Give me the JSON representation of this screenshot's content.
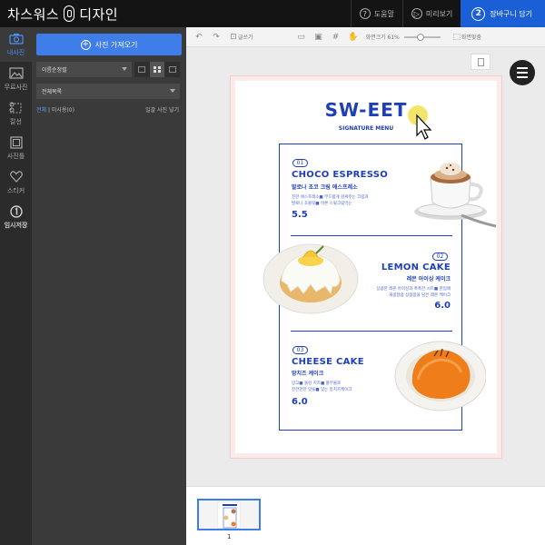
{
  "app": {
    "brand_left": "차스워스",
    "brand_right": "디자인"
  },
  "header": {
    "help": "도움말",
    "preview": "미리보기",
    "cart_step": "2",
    "cart": "장바구니 담기",
    "help_icon": "?",
    "preview_icon": "▷"
  },
  "rail": [
    {
      "label": "내사진",
      "icon": "camera-icon",
      "active": true
    },
    {
      "label": "무료사진",
      "icon": "landscape-icon",
      "active": false
    },
    {
      "label": "칼선",
      "icon": "scissors-icon",
      "active": false
    },
    {
      "label": "사진틀",
      "icon": "frame-icon",
      "active": false
    },
    {
      "label": "스티커",
      "icon": "heart-icon",
      "active": false
    },
    {
      "label": "임시저장",
      "icon": "save-one-icon",
      "active": false
    }
  ],
  "panel": {
    "import_button": "사진 가져오기",
    "sort_select": "이름순정렬",
    "folder_select": "전체목록",
    "tab_all": "전체",
    "tab_unused": "미사용(0)",
    "unused_hide": "일괄 사진 넣기"
  },
  "toolbar": {
    "text_label": "글쓰기",
    "zoom_label": "화면크기 61%",
    "fit_label": "화면맞춤",
    "zoom_percent": 61
  },
  "poster": {
    "title": "SW-EET",
    "subtitle": "SIGNATURE MENU",
    "items": [
      {
        "num": "01",
        "name": "CHOCO ESPRESSO",
        "kor": "발로나 초코 크림 에스프레소",
        "desc1": "진한 에스프레소■ 부드럽게 감싸주는 크림과",
        "desc2": "발로나 초콜릿■ 마른 스윗크림먹는",
        "price": "5.5"
      },
      {
        "num": "02",
        "name": "LEMON CAKE",
        "kor": "레몬 아이싱 케이크",
        "desc1": "상큼한 레몬 아이싱과 촉촉한 시트■ 한입에",
        "desc2": "새콤달콤 상큼함을 담은 레몬 케이크",
        "price": "6.0"
      },
      {
        "num": "03",
        "name": "CHEESE CAKE",
        "kor": "망치즈 케이크",
        "desc1": "망고■ 올린 치즈■ 폴부울로",
        "desc2": "진한한한 맛을■ 맞는 망치즈케이크",
        "price": "6.0"
      }
    ]
  },
  "pages": {
    "current": "1"
  }
}
